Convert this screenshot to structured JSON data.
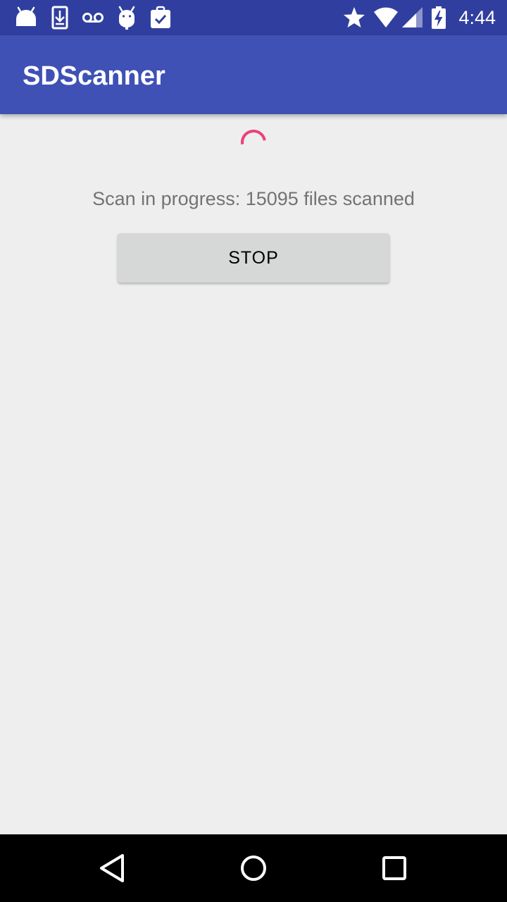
{
  "status_bar": {
    "time": "4:44",
    "icons": [
      "android-icon",
      "download-icon",
      "voicemail-icon",
      "android-debug-icon",
      "clipboard-check-icon",
      "star-icon",
      "wifi-icon",
      "signal-icon",
      "battery-charging-icon"
    ],
    "color": "#303f9f"
  },
  "app_bar": {
    "title": "SDScanner",
    "color": "#3f51b5"
  },
  "content": {
    "progress_spinner": "spinner-icon",
    "accent_color": "#ec407a",
    "status_text": "Scan in progress: 15095 files scanned",
    "stop_button_label": "STOP"
  },
  "nav_bar": {
    "icons": [
      "back-icon",
      "home-icon",
      "recents-icon"
    ]
  }
}
